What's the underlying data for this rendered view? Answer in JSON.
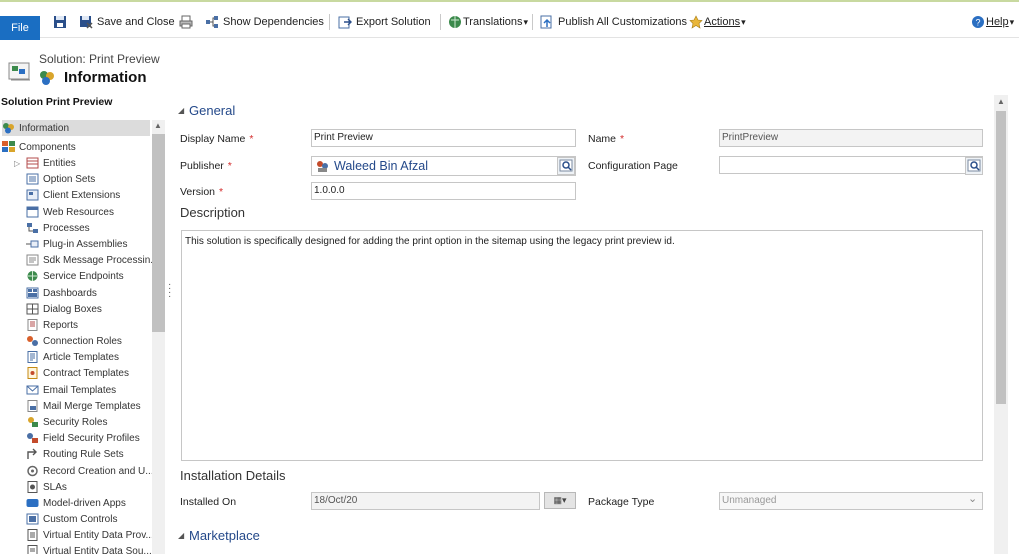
{
  "ribbon": {
    "file_label": "File",
    "save_close_label": "Save and Close",
    "show_dependencies_label": "Show Dependencies",
    "export_solution_label": "Export Solution",
    "translations_label": "Translations",
    "publish_all_label": "Publish All Customizations",
    "actions_label": "Actions",
    "help_label": "Help",
    "dropdown_glyph": "▾"
  },
  "header": {
    "subtitle": "Solution: Print Preview",
    "title": "Information"
  },
  "nav": {
    "heading": "Solution Print Preview",
    "items": [
      {
        "label": "Information",
        "icon": "information-icon"
      },
      {
        "label": "Components",
        "icon": "components-icon"
      },
      {
        "label": "Entities",
        "icon": "entities-icon"
      },
      {
        "label": "Option Sets",
        "icon": "option-sets-icon"
      },
      {
        "label": "Client Extensions",
        "icon": "client-extensions-icon"
      },
      {
        "label": "Web Resources",
        "icon": "web-resources-icon"
      },
      {
        "label": "Processes",
        "icon": "processes-icon"
      },
      {
        "label": "Plug-in Assemblies",
        "icon": "plugin-assemblies-icon"
      },
      {
        "label": "Sdk Message Processin...",
        "icon": "sdk-message-icon"
      },
      {
        "label": "Service Endpoints",
        "icon": "service-endpoints-icon"
      },
      {
        "label": "Dashboards",
        "icon": "dashboards-icon"
      },
      {
        "label": "Dialog Boxes",
        "icon": "dialog-boxes-icon"
      },
      {
        "label": "Reports",
        "icon": "reports-icon"
      },
      {
        "label": "Connection Roles",
        "icon": "connection-roles-icon"
      },
      {
        "label": "Article Templates",
        "icon": "article-templates-icon"
      },
      {
        "label": "Contract Templates",
        "icon": "contract-templates-icon"
      },
      {
        "label": "Email Templates",
        "icon": "email-templates-icon"
      },
      {
        "label": "Mail Merge Templates",
        "icon": "mail-merge-icon"
      },
      {
        "label": "Security Roles",
        "icon": "security-roles-icon"
      },
      {
        "label": "Field Security Profiles",
        "icon": "field-security-icon"
      },
      {
        "label": "Routing Rule Sets",
        "icon": "routing-rules-icon"
      },
      {
        "label": "Record Creation and U...",
        "icon": "record-creation-icon"
      },
      {
        "label": "SLAs",
        "icon": "slas-icon"
      },
      {
        "label": "Model-driven Apps",
        "icon": "model-driven-apps-icon"
      },
      {
        "label": "Custom Controls",
        "icon": "custom-controls-icon"
      },
      {
        "label": "Virtual Entity Data Prov...",
        "icon": "virtual-entity-provider-icon"
      },
      {
        "label": "Virtual Entity Data Sou...",
        "icon": "virtual-entity-source-icon"
      }
    ]
  },
  "form": {
    "general_heading": "General",
    "display_name_label": "Display Name",
    "display_name_value": "Print Preview",
    "name_label": "Name",
    "name_value": "PrintPreview",
    "publisher_label": "Publisher",
    "publisher_value": "Waleed Bin Afzal",
    "config_page_label": "Configuration Page",
    "config_page_value": "",
    "version_label": "Version",
    "version_value": "1.0.0.0",
    "description_heading": "Description",
    "description_value": "This solution is specifically designed for adding the print option in the sitemap using the legacy print preview id.",
    "installation_heading": "Installation Details",
    "installed_on_label": "Installed On",
    "installed_on_value": "18/Oct/20",
    "package_type_label": "Package Type",
    "package_type_value": "Unmanaged",
    "marketplace_heading": "Marketplace",
    "required_marker": "*"
  },
  "colors": {
    "file_button": "#1a6ec2",
    "section_heading": "#24498a",
    "required": "#d32b2b",
    "nav_selected": "#dcdcdc"
  }
}
